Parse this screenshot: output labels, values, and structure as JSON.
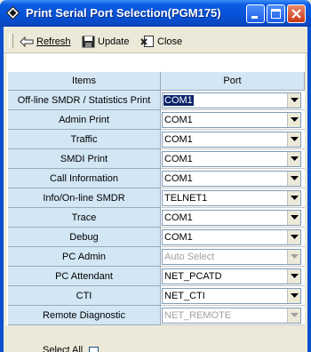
{
  "window": {
    "title": "Print Serial Port Selection(PGM175)"
  },
  "toolbar": {
    "refresh_label": "Refresh",
    "update_label": "Update",
    "close_label": "Close"
  },
  "grid": {
    "col_items": "Items",
    "col_port": "Port",
    "rows": [
      {
        "item": "Off-line SMDR / Statistics Print",
        "port": "COM1",
        "enabled": true,
        "selected": true
      },
      {
        "item": "Admin Print",
        "port": "COM1",
        "enabled": true
      },
      {
        "item": "Traffic",
        "port": "COM1",
        "enabled": true
      },
      {
        "item": "SMDI Print",
        "port": "COM1",
        "enabled": true
      },
      {
        "item": "Call Information",
        "port": "COM1",
        "enabled": true
      },
      {
        "item": "Info/On-line SMDR",
        "port": "TELNET1",
        "enabled": true
      },
      {
        "item": "Trace",
        "port": "COM1",
        "enabled": true
      },
      {
        "item": "Debug",
        "port": "COM1",
        "enabled": true
      },
      {
        "item": "PC Admin",
        "port": "Auto Select",
        "enabled": false
      },
      {
        "item": "PC Attendant",
        "port": "NET_PCATD",
        "enabled": true
      },
      {
        "item": "CTI",
        "port": "NET_CTI",
        "enabled": true
      },
      {
        "item": "Remote Diagnostic",
        "port": "NET_REMOTE",
        "enabled": false
      }
    ]
  },
  "status": {
    "select_all_label": "Select All"
  },
  "colors": {
    "title_bar": "#0552d6",
    "header_bg": "#d4e6f3",
    "selection": "#0a246a"
  }
}
